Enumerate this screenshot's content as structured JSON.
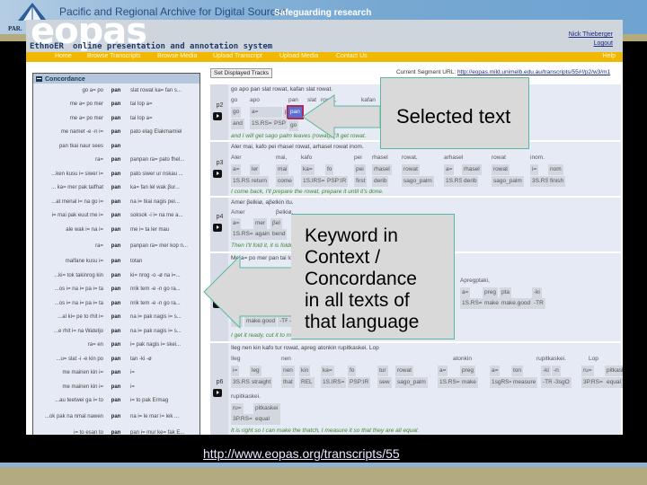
{
  "banner": {
    "archive_title": "Pacific and Regional Archive for Digital Sources",
    "tagline": "Safeguarding research",
    "org_short": "PARADISEC"
  },
  "app": {
    "logo": "eopas",
    "brand": "EthnoER",
    "subtitle": "online presentation and annotation system",
    "user": "Nick Thieberger",
    "logout": "Logout",
    "nav": [
      "Home",
      "Browse Transcripts",
      "Browse Media",
      "Upload Transcript",
      "Upload Media",
      "Contact Us"
    ],
    "help": "Help"
  },
  "concordance": {
    "title": "Concordance",
    "rows": [
      {
        "left": "go a= po",
        "kw": "pan",
        "right": "slat rowat ka= fan s..."
      },
      {
        "left": "me a= po mer",
        "kw": "pan",
        "right": "tai lop a="
      },
      {
        "left": "me a= po mer",
        "kw": "pan",
        "right": "tai lop a="
      },
      {
        "left": "me namet -e -n i=",
        "kw": "pan",
        "right": "pato elag Elakmamiel"
      },
      {
        "left": "pan tkai naur sees",
        "kw": "pan",
        "right": ""
      },
      {
        "left": "ra=",
        "kw": "pan",
        "right": "panpan ra= pato fhel..."
      },
      {
        "left": "...ken kusu i= siwer i=",
        "kw": "pan",
        "right": "pato siwer ur nskau ..."
      },
      {
        "left": "... ka= mer pak taifhat",
        "kw": "pan",
        "right": "ka= fan lel wak βur..."
      },
      {
        "left": "...at menal i= na go i=",
        "kw": "pan",
        "right": "na i= tkai nagis pei..."
      },
      {
        "left": "i= mai pak euut me i=",
        "kw": "pan",
        "right": "soksok -i i= na me a..."
      },
      {
        "left": "ale wak i= na i=",
        "kw": "pan",
        "right": "me i= ta ler mau"
      },
      {
        "left": "ra=",
        "kw": "pan",
        "right": "panpan ra= mer kop n...",
        "tall": true
      },
      {
        "left": "malfane kusu i=",
        "kw": "pan",
        "right": "totan"
      },
      {
        "left": "...ki= tok takinrog kin",
        "kw": "pan",
        "right": "ki= nrog -o -ø na i=..."
      },
      {
        "left": "...os i= na i= pa i= ta",
        "kw": "pan",
        "right": "nrik tem -e -n go ra..."
      },
      {
        "left": "...os i= na i= pa i= ta",
        "kw": "pan",
        "right": "nrik tem -e -n go ra..."
      },
      {
        "left": "...al ki= pe to rhit i=",
        "kw": "pan",
        "right": "na i= pak nagis i= s..."
      },
      {
        "left": "...e rhit i= na Watetjo",
        "kw": "pan",
        "right": "na i= pak nagis i= s..."
      },
      {
        "left": "ra= en",
        "kw": "pan",
        "right": "i= pak nagis i= skei..."
      },
      {
        "left": "...u= slat -i -e kin po",
        "kw": "pan",
        "right": "tan -ki -ø"
      },
      {
        "left": "me mainen kin i=",
        "kw": "pan",
        "right": "i="
      },
      {
        "left": "me mainen kin i=",
        "kw": "pan",
        "right": "i="
      },
      {
        "left": "...au teetwei ga i= to",
        "kw": "pan",
        "right": "i= to pak Ermag"
      },
      {
        "left": "...ok pak na nmal nawen",
        "kw": "pan",
        "right": "na i= le mar i= lek ...",
        "tall": true
      },
      {
        "left": "i= to esan to",
        "kw": "pan",
        "right": "pan i= mur ke= fak E..."
      }
    ]
  },
  "transcript": {
    "set_tracks_label": "Set Displayed Tracks",
    "segment_url_label": "Current Segment URL:",
    "segment_url": "http://eopas.mild.unimelb.edu.au/transcripts/55#!/p2/w3/m1",
    "phrases": {
      "p2": {
        "id": "p2",
        "text": "go apo pan slat rowat, kafan slat rowat.",
        "words": [
          "go",
          "apo",
          "pan",
          "slat",
          "rowat,",
          "kafan"
        ],
        "morphs": [
          "go",
          "a=",
          "po",
          "pan"
        ],
        "gloss": [
          "and",
          "1S.RS=",
          "PSP",
          "go"
        ],
        "translation": "and I will get sago palm leaves (rowat), I'll get rowat."
      },
      "p3": {
        "id": "p3",
        "text": "Aler mai, kafo pei rhasel rowat, arhasel rowat inom.",
        "words": [
          "Aler",
          "mai,",
          "kafo",
          "pei",
          "rhasel",
          "rowat,",
          "arhasel",
          "rowat",
          "inom."
        ],
        "morphs": [
          "a=",
          "ler",
          "mai",
          "ka=",
          "fo",
          "pei",
          "rhasel",
          "rowat",
          "a=",
          "rhasel",
          "rowat",
          "i=",
          "nom"
        ],
        "gloss": [
          "1S.RS=",
          "return",
          "come",
          "1S.IRS=",
          "PSP:IR",
          "first",
          "derib",
          "sago_palm",
          "1S.RS=",
          "derib",
          "sago_palm",
          "3S.RS=",
          "finish"
        ],
        "translation": "I come back, I'll prepare the rowat, prepare it until it's done."
      },
      "p4": {
        "id": "p4",
        "text": "Amer βelkiø, aβelkin itu.",
        "words": [
          "Amer",
          "βelkiø,",
          "aβelkin",
          "itu."
        ],
        "morphs": [
          "a=",
          "mer",
          "βel"
        ],
        "gloss": [
          "1S.RS=",
          "again",
          "bend"
        ],
        "translation": "Then I'll fold it, it is folde..."
      },
      "p5": {
        "id": "p5",
        "text": "Me a= po mer pan tai lop ...",
        "words_partial": [
          "Apregptaki,"
        ],
        "morphs": [
          "pta",
          "-ki",
          "-ø",
          "a=",
          "preg",
          "pta",
          "-ki"
        ],
        "gloss": [
          "cut",
          "make.good",
          "-TR",
          "-3S",
          "1S.RS=",
          "make",
          "make.good",
          "-TR"
        ],
        "translation": "I get it ready, cut it to m..."
      },
      "p6": {
        "id": "p6",
        "text": "Ileg nen kin kafo tur rowat, apreg atonkin rupitkaskei. Lop",
        "words": [
          "Ileg",
          "nen",
          "atonkin",
          "rupitkaskei.",
          "Lop"
        ],
        "morphs": [
          "i=",
          "leg",
          "nen",
          "kin",
          "ka=",
          "fo",
          "tur",
          "rowat",
          "a=",
          "preg",
          "a=",
          "ton",
          "-ki",
          "-n",
          "ru=",
          "pitkaskei",
          "lop"
        ],
        "gloss": [
          "3S.RS=",
          "straight",
          "that",
          "REL",
          "1S.IRS=",
          "PSP:IR",
          "sew",
          "sago_palm",
          "1S.RS=",
          "make",
          "1sgRS=",
          "measure",
          "-TR",
          "-3sgO",
          "3P.RS=",
          "equal",
          "bamboo"
        ],
        "line2_word": "rupitkaskei.",
        "line2_morphs": [
          "ru=",
          "pitkaskei"
        ],
        "line2_gloss": [
          "3P.RS=",
          "equal"
        ],
        "translation": "It is right so I can make the thatch, I measure it so that they are all equal."
      }
    }
  },
  "callouts": {
    "selected": "Selected text",
    "kwic": [
      "Keyword in",
      "Context /",
      "Concordance",
      "in all texts of",
      "that language"
    ]
  },
  "footer": {
    "url": "http://www.eopas.org/transcripts/55"
  },
  "colors": {
    "nav_bar": "#f0b800",
    "header_bg": "#cfd5dd",
    "panel_bg": "#e6eaf5",
    "translation_green": "#3d8a2a",
    "callout_border": "#5ab8a0",
    "selection": "#b0285a"
  }
}
